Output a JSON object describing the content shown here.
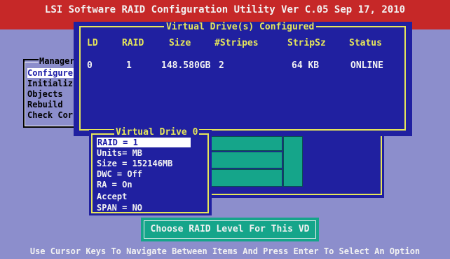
{
  "app": {
    "title": "LSI Software RAID Configuration Utility Ver C.05 Sep 17, 2010"
  },
  "status_bar": {
    "text": "Use Cursor Keys To Navigate Between Items And Press Enter To Select An Option"
  },
  "management_menu": {
    "title": "Manager",
    "items": [
      "Configure",
      "Initializ",
      "Objects",
      "Rebuild",
      "Check Cor"
    ],
    "selected_index": 0
  },
  "vd_configured": {
    "title": "Virtual Drive(s) Configured",
    "columns": [
      "LD",
      "RAID",
      "Size",
      "#Stripes",
      "StripSz",
      "Status"
    ],
    "rows": [
      {
        "ld": "0",
        "raid": "1",
        "size": "148.580GB",
        "stripes": "2",
        "stripsz": "64 KB",
        "status": "ONLINE"
      }
    ]
  },
  "vd0_menu": {
    "title": "Virtual Drive 0",
    "items": [
      "RAID = 1",
      "Units= MB",
      "Size = 152146MB",
      "DWC  = Off",
      "RA   = On",
      "Accept",
      "SPAN = NO"
    ],
    "selected_index": 0
  },
  "prompt": {
    "text": "Choose RAID Level For This VD"
  },
  "colors": {
    "title_bar": "#c62828",
    "desktop": "#8c8ecc",
    "panel": "#2020a0",
    "border": "#e6e65a",
    "teal": "#15a58a"
  }
}
